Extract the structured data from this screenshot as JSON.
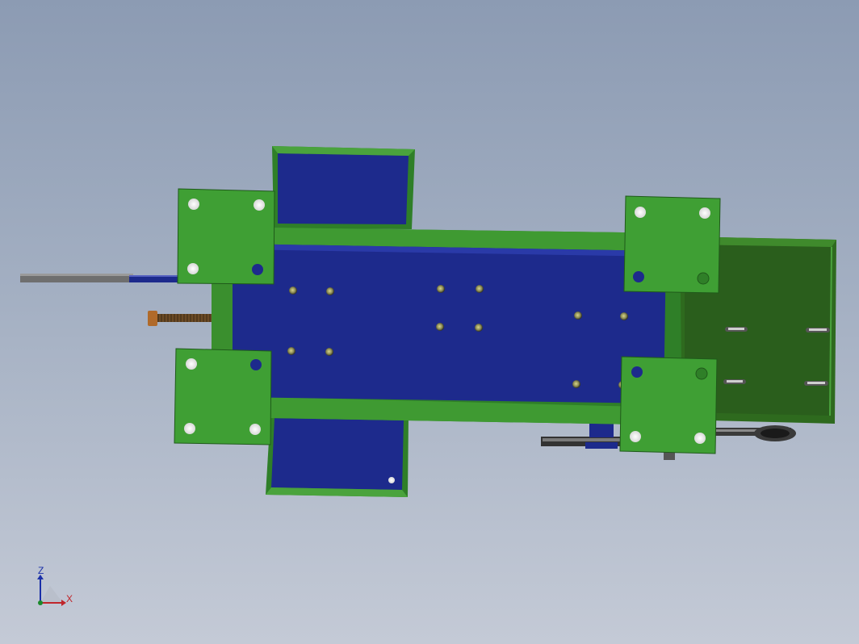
{
  "viewport": {
    "background_top": "#8c9bb3",
    "background_bottom": "#c4cad6"
  },
  "colors": {
    "plate_green": "#3f9f34",
    "plate_green_dark": "#1f5a1a",
    "frame_green": "#2e7a25",
    "inner_blue": "#1d2a8c",
    "motor_green": "#2f6d1f",
    "rod_gray": "#6e6e6e",
    "bolt_brown": "#8a5a2a"
  },
  "triad": {
    "z_label": "Z",
    "x_label": "X",
    "z_color": "#1a2fa8",
    "x_color": "#c0262b"
  }
}
